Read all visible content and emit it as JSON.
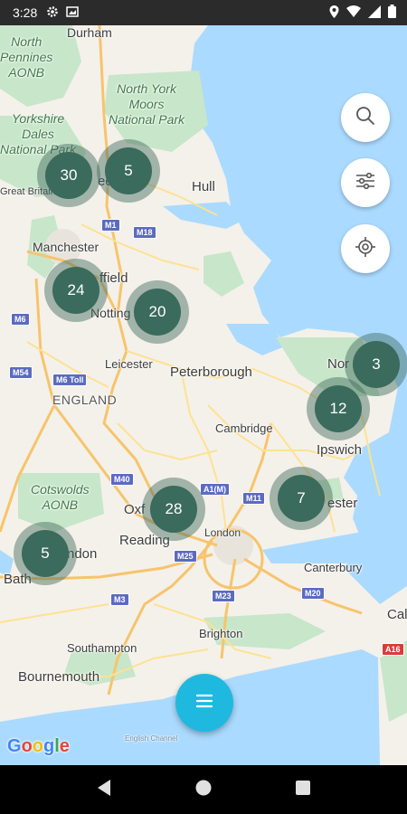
{
  "status_bar": {
    "time": "3:28"
  },
  "map": {
    "places": {
      "durham": "Durham",
      "north_pennines": "North\nPennines\nAONB",
      "north_york_moors": "North York\nMoors\nNational Park",
      "yorkshire_park": "Yorkshire\nDales\nNational Park",
      "great_britain": "Great Britain",
      "leeds": "eds",
      "hull": "Hull",
      "manchester": "Manchester",
      "sheffield": "ffield",
      "nottingham": "Notting",
      "leicester": "Leicester",
      "peterborough": "Peterborough",
      "england": "ENGLAND",
      "norwich": "Nor",
      "cambridge": "Cambridge",
      "ipswich": "Ipswich",
      "cotswolds": "Cotswolds\nAONB",
      "oxford": "Oxf",
      "colchester": "ester",
      "reading": "Reading",
      "london": "London",
      "swindon": "ndon",
      "bath": "Bath",
      "canterbury": "Canterbury",
      "brighton": "Brighton",
      "southampton": "Southampton",
      "bournemouth": "Bournemouth",
      "calais": "Cal",
      "english_channel": "English Channel"
    },
    "roads": {
      "m1": "M1",
      "m18": "M18",
      "m6": "M6",
      "m54": "M54",
      "m6toll": "M6 Toll",
      "m40": "M40",
      "a1m": "A1(M)",
      "m11": "M11",
      "m25": "M25",
      "m3": "M3",
      "m23": "M23",
      "m20": "M20",
      "a16": "A16"
    },
    "clusters": [
      {
        "id": "leeds-west",
        "count": "30"
      },
      {
        "id": "leeds-east",
        "count": "5"
      },
      {
        "id": "sheffield",
        "count": "24"
      },
      {
        "id": "nottingham",
        "count": "20"
      },
      {
        "id": "norwich",
        "count": "3"
      },
      {
        "id": "ipswich",
        "count": "12"
      },
      {
        "id": "colchester",
        "count": "7"
      },
      {
        "id": "oxford",
        "count": "28"
      },
      {
        "id": "swindon",
        "count": "5"
      }
    ],
    "attribution": "Google"
  },
  "controls": {
    "search_icon": "search-icon",
    "filter_icon": "sliders-icon",
    "locate_icon": "crosshair-icon",
    "menu_icon": "hamburger-icon"
  },
  "colors": {
    "cluster": "#3a6b5c",
    "fab": "#1fb9e0",
    "water": "#aadaff",
    "park": "#c8e6c9"
  }
}
